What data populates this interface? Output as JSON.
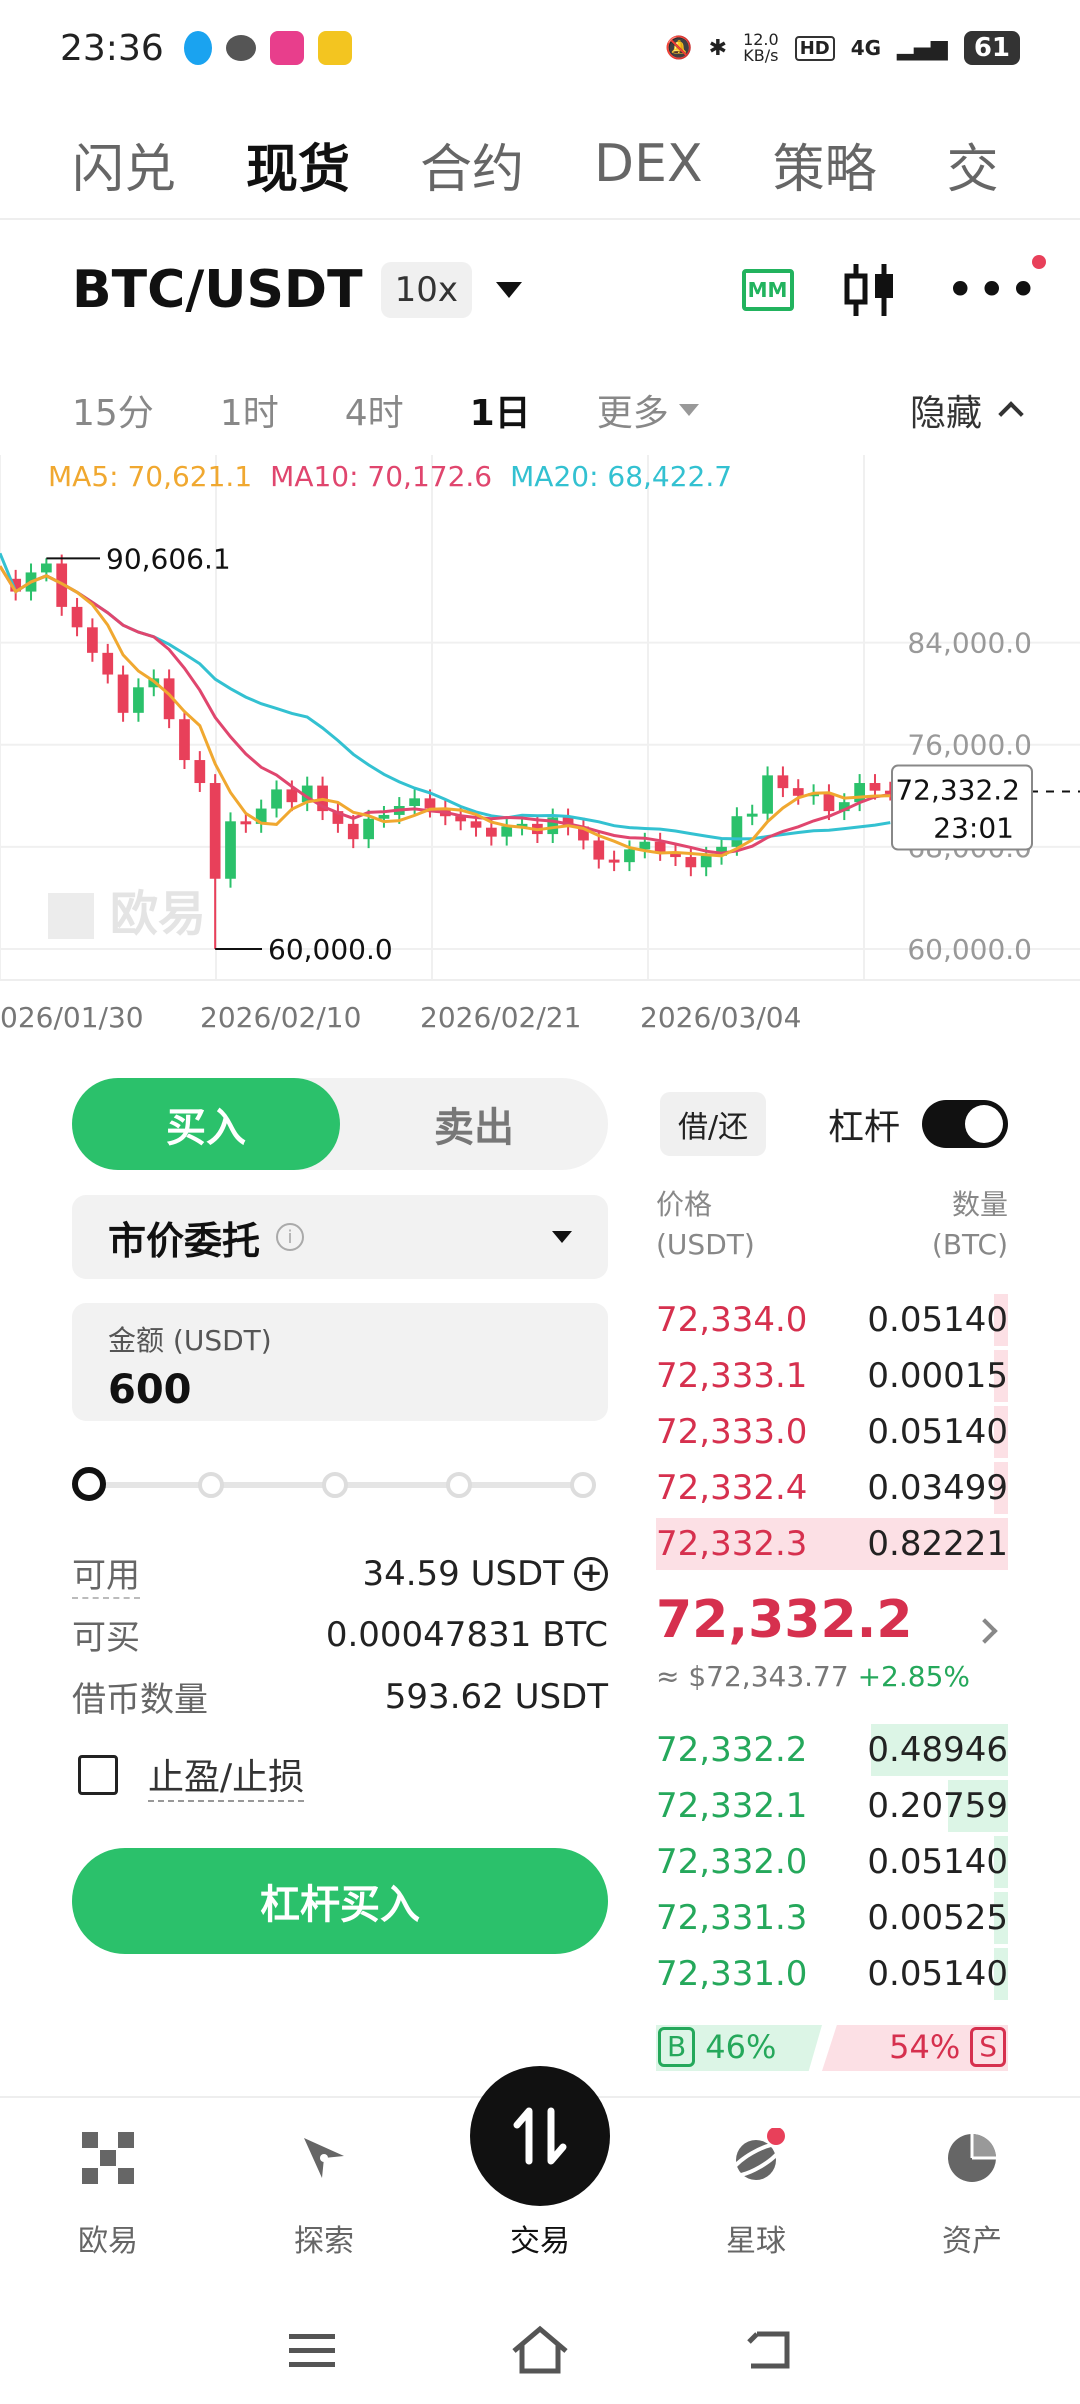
{
  "status_bar": {
    "time": "23:36",
    "net_speed_value": "12.0",
    "net_speed_unit": "KB/s",
    "hd": "HD",
    "network": "4G",
    "battery": "61"
  },
  "top_tabs": [
    {
      "label": "闪兑",
      "active": false
    },
    {
      "label": "现货",
      "active": true
    },
    {
      "label": "合约",
      "active": false
    },
    {
      "label": "DEX",
      "active": false
    },
    {
      "label": "策略",
      "active": false
    },
    {
      "label": "交",
      "active": false
    }
  ],
  "pair": {
    "symbol": "BTC/USDT",
    "leverage": "10x",
    "mm_label": "MM"
  },
  "timeframes": {
    "items": [
      "15分",
      "1时",
      "4时",
      "1日"
    ],
    "active": "1日",
    "more": "更多",
    "hide": "隐藏"
  },
  "chart_data": {
    "type": "candlestick",
    "ma_legend": {
      "ma5": "MA5: 70,621.1",
      "ma10": "MA10: 70,172.6",
      "ma20": "MA20: 68,422.7"
    },
    "y_ticks": [
      "84,000.0",
      "76,000.0",
      "68,000.0",
      "60,000.0"
    ],
    "x_ticks": [
      "026/01/30",
      "2026/02/10",
      "2026/02/21",
      "2026/03/04"
    ],
    "high_label": "90,606.1",
    "low_label": "60,000.0",
    "last_price_label": "72,332.2",
    "countdown_label": "23:01",
    "watermark": "欧易",
    "colors": {
      "up": "#2bc16b",
      "down": "#e8405a",
      "ma5": "#f0a830",
      "ma10": "#e0466e",
      "ma20": "#33c1d1"
    }
  },
  "order_form": {
    "buy_label": "买入",
    "sell_label": "卖出",
    "order_type": "市价委托",
    "amount_label": "金额 (USDT)",
    "amount_value": "600",
    "available_label": "可用",
    "available_value": "34.59 USDT",
    "can_buy_label": "可买",
    "can_buy_value": "0.00047831 BTC",
    "borrow_label": "借币数量",
    "borrow_value": "593.62 USDT",
    "tpsl_label": "止盈/止损",
    "submit_label": "杠杆买入",
    "slider_percent": 0
  },
  "order_book": {
    "borrow_repay": "借/还",
    "leverage_label": "杠杆",
    "leverage_on": true,
    "price_header_1": "价格",
    "price_header_2": "(USDT)",
    "qty_header_1": "数量",
    "qty_header_2": "(BTC)",
    "asks": [
      {
        "price": "72,334.0",
        "qty": "0.05140",
        "depth": 0.04
      },
      {
        "price": "72,333.1",
        "qty": "0.00015",
        "depth": 0.04
      },
      {
        "price": "72,333.0",
        "qty": "0.05140",
        "depth": 0.04
      },
      {
        "price": "72,332.4",
        "qty": "0.03499",
        "depth": 0.04
      },
      {
        "price": "72,332.3",
        "qty": "0.82221",
        "depth": 1.0
      }
    ],
    "last_price": "72,332.2",
    "last_usd": "≈ $72,343.77",
    "last_change": "+2.85%",
    "bids": [
      {
        "price": "72,332.2",
        "qty": "0.48946",
        "depth": 0.39
      },
      {
        "price": "72,332.1",
        "qty": "0.20759",
        "depth": 0.17
      },
      {
        "price": "72,332.0",
        "qty": "0.05140",
        "depth": 0.04
      },
      {
        "price": "72,331.3",
        "qty": "0.00525",
        "depth": 0.04
      },
      {
        "price": "72,331.0",
        "qty": "0.05140",
        "depth": 0.04
      }
    ],
    "buy_ratio_label": "B",
    "buy_ratio": "46%",
    "sell_ratio_label": "S",
    "sell_ratio": "54%"
  },
  "bottom_nav": [
    {
      "label": "欧易",
      "icon": "okx-logo-icon",
      "active": false
    },
    {
      "label": "探索",
      "icon": "compass-icon",
      "active": false
    },
    {
      "label": "交易",
      "icon": "swap-arrows-icon",
      "active": true
    },
    {
      "label": "星球",
      "icon": "planet-icon",
      "active": false
    },
    {
      "label": "资产",
      "icon": "pie-chart-icon",
      "active": false
    }
  ]
}
